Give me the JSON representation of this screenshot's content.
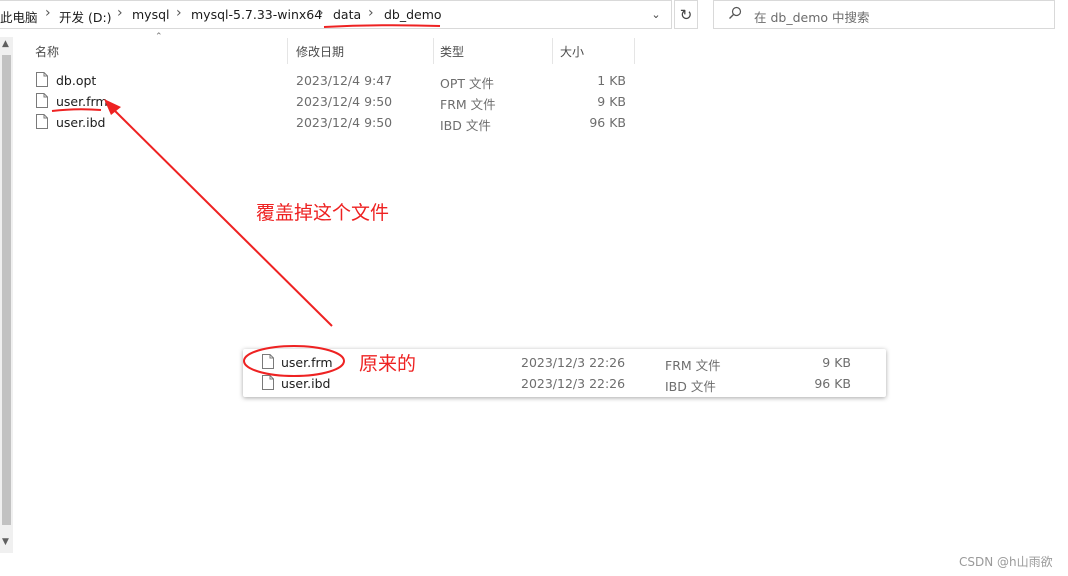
{
  "breadcrumb": {
    "items": [
      "此电脑",
      "开发 (D:)",
      "mysql",
      "mysql-5.7.33-winx64",
      "data",
      "db_demo"
    ],
    "separator": "›"
  },
  "search": {
    "placeholder": "在 db_demo 中搜索"
  },
  "columns": {
    "name": "名称",
    "modified": "修改日期",
    "type": "类型",
    "size": "大小"
  },
  "files": [
    {
      "name": "db.opt",
      "modified": "2023/12/4 9:47",
      "type": "OPT 文件",
      "size": "1 KB"
    },
    {
      "name": "user.frm",
      "modified": "2023/12/4 9:50",
      "type": "FRM 文件",
      "size": "9 KB"
    },
    {
      "name": "user.ibd",
      "modified": "2023/12/4 9:50",
      "type": "IBD 文件",
      "size": "96 KB"
    }
  ],
  "annotations": {
    "overwrite": "覆盖掉这个文件",
    "original": "原来的"
  },
  "original_files": [
    {
      "name": "user.frm",
      "modified": "2023/12/3 22:26",
      "type": "FRM 文件",
      "size": "9 KB"
    },
    {
      "name": "user.ibd",
      "modified": "2023/12/3 22:26",
      "type": "IBD 文件",
      "size": "96 KB"
    }
  ],
  "watermark": "CSDN @h山雨欲",
  "colors": {
    "annotation": "#ee2222"
  },
  "icons": [
    "chevron-down-icon",
    "refresh-icon",
    "search-icon",
    "file-icon",
    "sort-up-icon"
  ]
}
